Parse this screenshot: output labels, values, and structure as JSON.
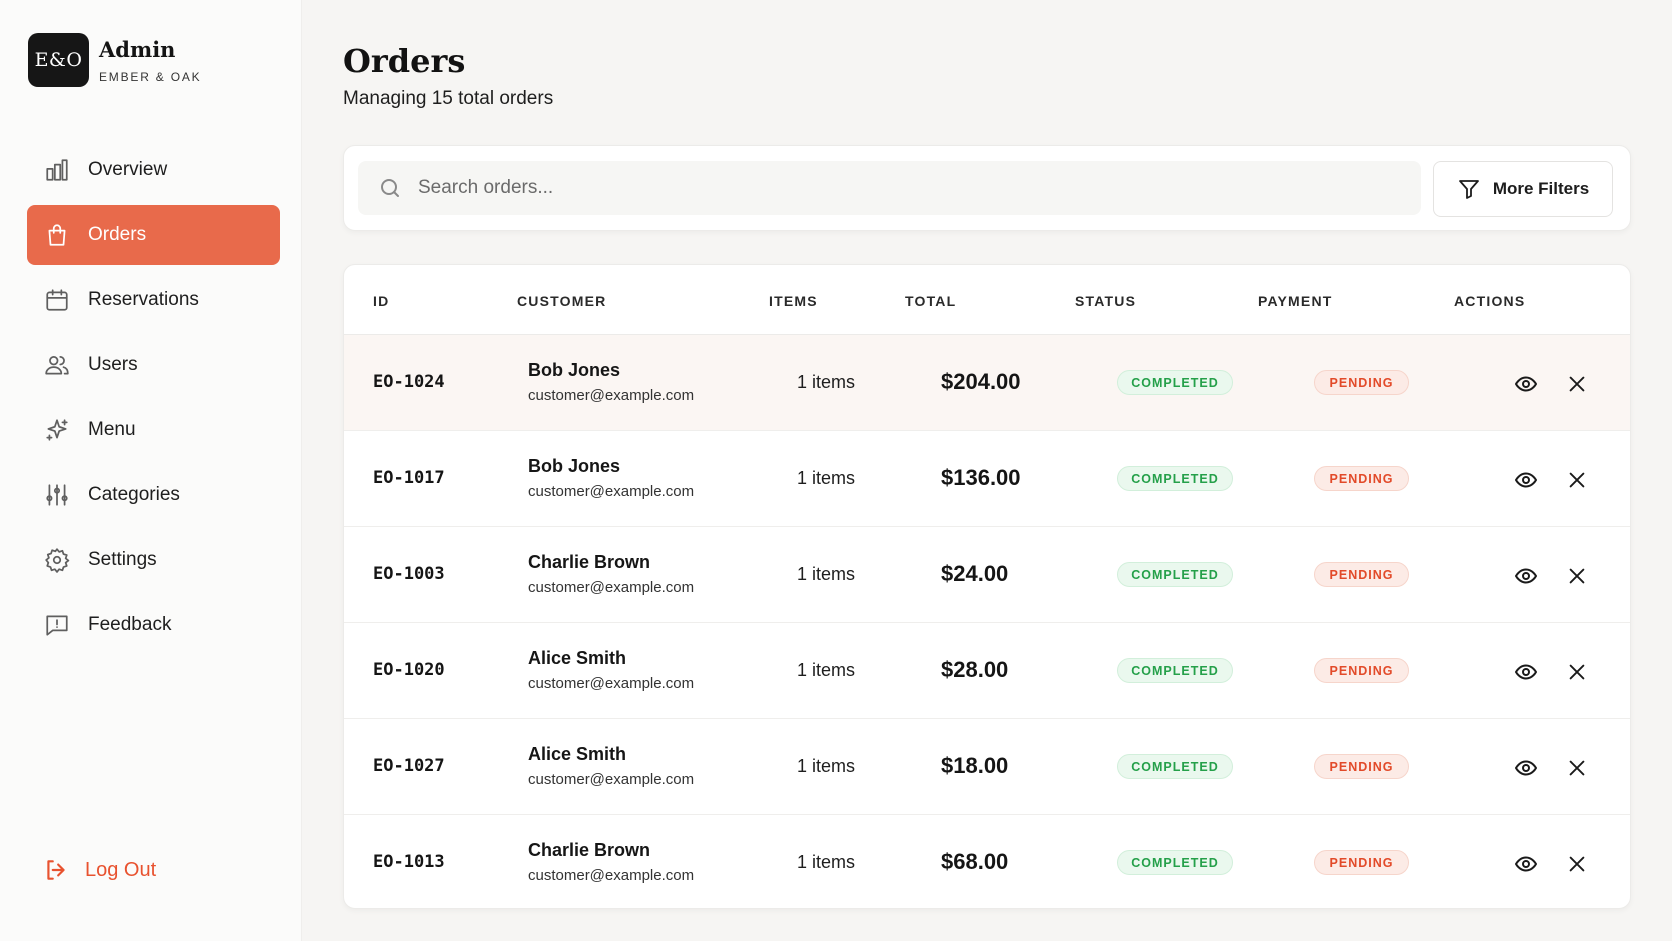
{
  "brand": {
    "logo": "E&O",
    "title": "Admin",
    "subtitle": "EMBER & OAK"
  },
  "sidebar": {
    "items": [
      {
        "label": "Overview",
        "icon": "bar-chart-icon",
        "active": false
      },
      {
        "label": "Orders",
        "icon": "shopping-bag-icon",
        "active": true
      },
      {
        "label": "Reservations",
        "icon": "calendar-icon",
        "active": false
      },
      {
        "label": "Users",
        "icon": "users-icon",
        "active": false
      },
      {
        "label": "Menu",
        "icon": "sparkles-icon",
        "active": false
      },
      {
        "label": "Categories",
        "icon": "sliders-icon",
        "active": false
      },
      {
        "label": "Settings",
        "icon": "gear-icon",
        "active": false
      },
      {
        "label": "Feedback",
        "icon": "message-alert-icon",
        "active": false
      }
    ],
    "logout_label": "Log Out"
  },
  "page": {
    "title": "Orders",
    "subtitle": "Managing 15 total orders"
  },
  "search": {
    "placeholder": "Search orders..."
  },
  "filters": {
    "more_label": "More Filters"
  },
  "table": {
    "columns": [
      "ID",
      "CUSTOMER",
      "ITEMS",
      "TOTAL",
      "STATUS",
      "PAYMENT",
      "ACTIONS"
    ],
    "rows": [
      {
        "id": "EO-1024",
        "name": "Bob Jones",
        "email": "customer@example.com",
        "items": "1 items",
        "total": "$204.00",
        "status": "COMPLETED",
        "payment": "PENDING"
      },
      {
        "id": "EO-1017",
        "name": "Bob Jones",
        "email": "customer@example.com",
        "items": "1 items",
        "total": "$136.00",
        "status": "COMPLETED",
        "payment": "PENDING"
      },
      {
        "id": "EO-1003",
        "name": "Charlie Brown",
        "email": "customer@example.com",
        "items": "1 items",
        "total": "$24.00",
        "status": "COMPLETED",
        "payment": "PENDING"
      },
      {
        "id": "EO-1020",
        "name": "Alice Smith",
        "email": "customer@example.com",
        "items": "1 items",
        "total": "$28.00",
        "status": "COMPLETED",
        "payment": "PENDING"
      },
      {
        "id": "EO-1027",
        "name": "Alice Smith",
        "email": "customer@example.com",
        "items": "1 items",
        "total": "$18.00",
        "status": "COMPLETED",
        "payment": "PENDING"
      },
      {
        "id": "EO-1013",
        "name": "Charlie Brown",
        "email": "customer@example.com",
        "items": "1 items",
        "total": "$68.00",
        "status": "COMPLETED",
        "payment": "PENDING"
      }
    ]
  },
  "colors": {
    "accent": "#e86a4b",
    "success": "#25a04a",
    "danger": "#e24a29",
    "logo_bg": "#161616"
  }
}
